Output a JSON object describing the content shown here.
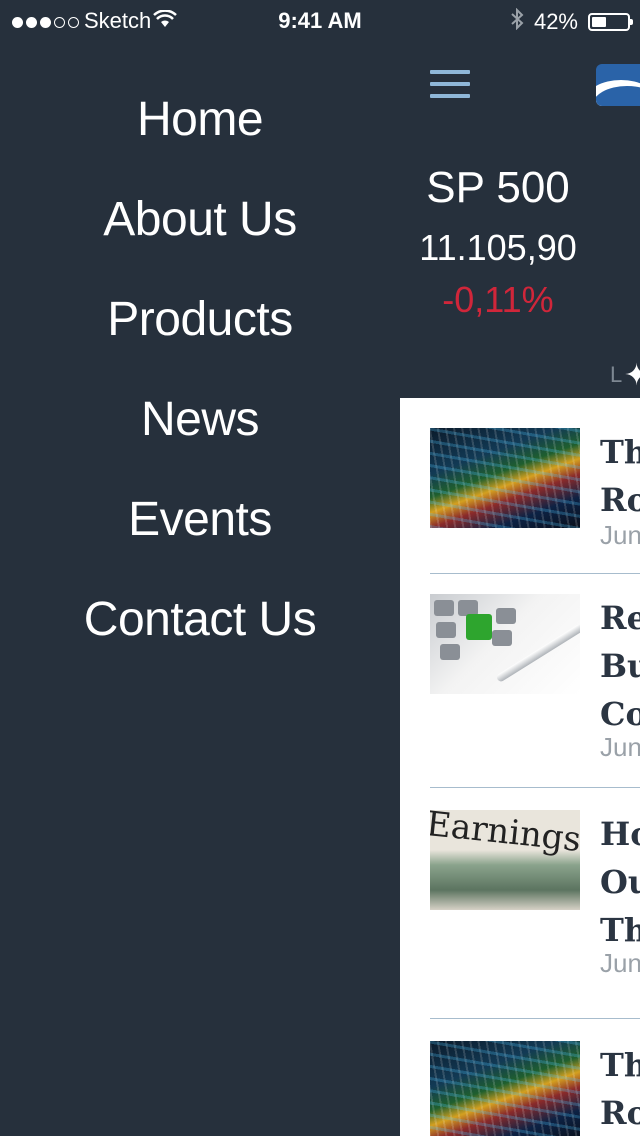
{
  "status_bar": {
    "carrier": "Sketch",
    "time": "9:41 AM",
    "battery": "42%",
    "battery_level": 0.42,
    "signal_dots_filled": 3,
    "signal_dots_total": 5
  },
  "menu": {
    "items": [
      "Home",
      "About Us",
      "Products",
      "News",
      "Events",
      "Contact Us"
    ]
  },
  "ticker": {
    "name": "SP 500",
    "value": "11.105,90",
    "change": "-0,11%",
    "change_color": "#d0263a"
  },
  "cut_off_label": "L",
  "articles": [
    {
      "title_lines": [
        "Th",
        "Ro"
      ],
      "date": "June",
      "thumb": "stock-market-image"
    },
    {
      "title_lines": [
        "Re",
        "Bu",
        "Co"
      ],
      "date": "June",
      "thumb": "calculator-pen-image"
    },
    {
      "title_lines": [
        "Ho",
        "Ou",
        "Th"
      ],
      "date": "June",
      "thumb": "earnings-dollar-image"
    },
    {
      "title_lines": [
        "Th",
        "Ro"
      ],
      "date": "",
      "thumb": "stock-market-image"
    }
  ],
  "colors": {
    "background": "#26303c",
    "panel": "#ffffff",
    "hamburger": "#8fb7d8",
    "logo": "#2a63a8",
    "title_text": "#2b3542",
    "date_text": "#9aa1a8"
  }
}
